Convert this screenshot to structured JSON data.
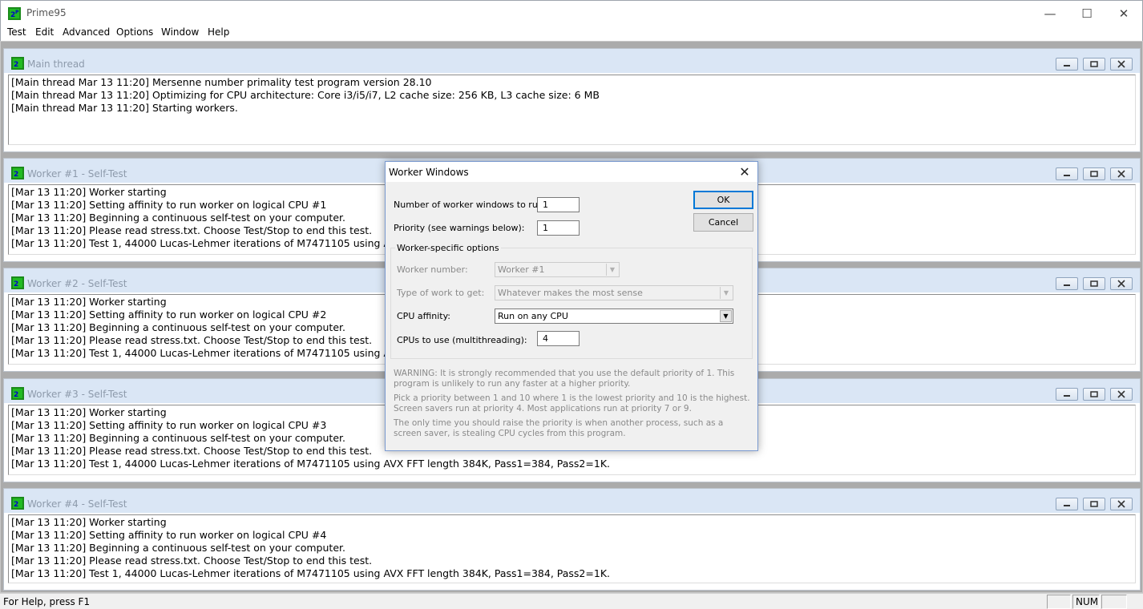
{
  "window": {
    "title": "Prime95",
    "controls": {
      "minimize": "—",
      "maximize": "☐",
      "close": "✕"
    }
  },
  "menu": [
    "Test",
    "Edit",
    "Advanced",
    "Options",
    "Window",
    "Help"
  ],
  "children": [
    {
      "title": "Main thread",
      "lines": [
        "[Main thread Mar 13 11:20] Mersenne number primality test program version 28.10",
        "[Main thread Mar 13 11:20] Optimizing for CPU architecture: Core i3/i5/i7, L2 cache size: 256 KB, L3 cache size: 6 MB",
        "[Main thread Mar 13 11:20] Starting workers."
      ]
    },
    {
      "title": "Worker #1 - Self-Test",
      "lines": [
        "[Mar 13 11:20] Worker starting",
        "[Mar 13 11:20] Setting affinity to run worker on logical CPU #1",
        "[Mar 13 11:20] Beginning a continuous self-test on your computer.",
        "[Mar 13 11:20] Please read stress.txt.  Choose Test/Stop to end this test.",
        "[Mar 13 11:20] Test 1, 44000 Lucas-Lehmer iterations of M7471105 using AVX FFT length 384K, Pass1=384, Pass2=1K."
      ]
    },
    {
      "title": "Worker #2 - Self-Test",
      "lines": [
        "[Mar 13 11:20] Worker starting",
        "[Mar 13 11:20] Setting affinity to run worker on logical CPU #2",
        "[Mar 13 11:20] Beginning a continuous self-test on your computer.",
        "[Mar 13 11:20] Please read stress.txt.  Choose Test/Stop to end this test.",
        "[Mar 13 11:20] Test 1, 44000 Lucas-Lehmer iterations of M7471105 using AVX FFT length 384K, Pass1=384, Pass2=1K."
      ]
    },
    {
      "title": "Worker #3 - Self-Test",
      "lines": [
        "[Mar 13 11:20] Worker starting",
        "[Mar 13 11:20] Setting affinity to run worker on logical CPU #3",
        "[Mar 13 11:20] Beginning a continuous self-test on your computer.",
        "[Mar 13 11:20] Please read stress.txt.  Choose Test/Stop to end this test.",
        "[Mar 13 11:20] Test 1, 44000 Lucas-Lehmer iterations of M7471105 using AVX FFT length 384K, Pass1=384, Pass2=1K."
      ]
    },
    {
      "title": "Worker #4 - Self-Test",
      "lines": [
        "[Mar 13 11:20] Worker starting",
        "[Mar 13 11:20] Setting affinity to run worker on logical CPU #4",
        "[Mar 13 11:20] Beginning a continuous self-test on your computer.",
        "[Mar 13 11:20] Please read stress.txt.  Choose Test/Stop to end this test.",
        "[Mar 13 11:20] Test 1, 44000 Lucas-Lehmer iterations of M7471105 using AVX FFT length 384K, Pass1=384, Pass2=1K."
      ]
    }
  ],
  "dialog": {
    "title": "Worker Windows",
    "close": "✕",
    "num_workers_label": "Number of worker windows to run:",
    "num_workers_value": "1",
    "priority_label": "Priority (see warnings below):",
    "priority_value": "1",
    "ok_label": "OK",
    "cancel_label": "Cancel",
    "group_label": "Worker-specific options",
    "worker_number_label": "Worker number:",
    "worker_number_value": "Worker #1",
    "work_type_label": "Type of work to get:",
    "work_type_value": "Whatever makes the most sense",
    "affinity_label": "CPU affinity:",
    "affinity_value": "Run on any CPU",
    "cpus_label": "CPUs to use (multithreading):",
    "cpus_value": "4",
    "warning1": "WARNING: It is strongly recommended that you use the default priority of 1.  This program is unlikely to run any faster at a higher priority.",
    "warning2": "Pick a priority between 1 and 10 where 1 is the lowest priority and 10 is the highest. Screen savers run at priority 4.  Most applications run at priority 7 or 9.",
    "warning3": "The only time you should raise the priority is when another process, such as a screen saver, is stealing CPU cycles from this program."
  },
  "statusbar": {
    "help_text": "For Help, press F1",
    "num_indicator": "NUM"
  }
}
